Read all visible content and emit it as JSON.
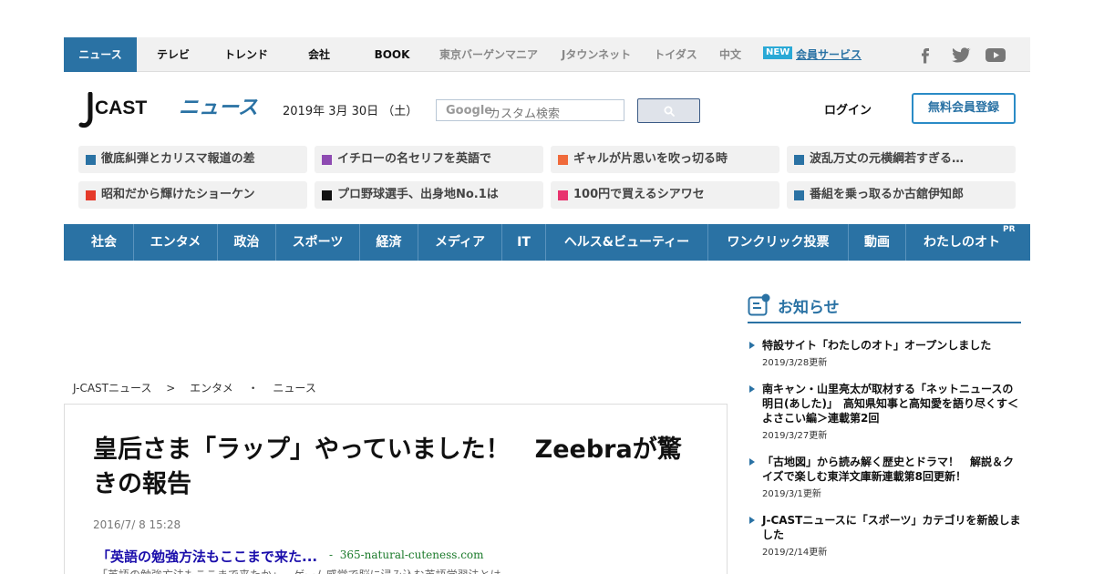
{
  "topnav": {
    "items": [
      "ニュース",
      "テレビ",
      "トレンド",
      "会社",
      "BOOK",
      "東京バーゲンマニア",
      "Jタウンネット",
      "トイダス",
      "中文"
    ],
    "new_badge": "NEW",
    "member_link": "会員サービス",
    "social_icons": [
      "facebook-icon",
      "twitter-icon",
      "youtube-icon"
    ]
  },
  "header": {
    "logo_j": "J",
    "logo_cast": "CAST",
    "logo_news": "ニュース",
    "date": "2019年 3月 30日 （土）",
    "search_brand": "Google",
    "search_placeholder": "カスタム検索",
    "login": "ログイン",
    "register": "無料会員登録"
  },
  "headlines": [
    {
      "text": "徹底糾弾とカリスマ報道の差",
      "color": "#2a72a4"
    },
    {
      "text": "イチローの名セリフを英語で",
      "color": "#8e4bb2"
    },
    {
      "text": "ギャルが片思いを吹っ切る時",
      "color": "#f06a3b"
    },
    {
      "text": "波乱万丈の元横綱若すぎる…",
      "color": "#2a72a4"
    },
    {
      "text": "昭和だから輝けたショーケン",
      "color": "#e53a2a"
    },
    {
      "text": "プロ野球選手、出身地No.1は",
      "color": "#111111"
    },
    {
      "text": "100円で買えるシアワセ",
      "color": "#e8336e"
    },
    {
      "text": "番組を乗っ取るか古舘伊知郎",
      "color": "#2a72a4"
    }
  ],
  "categories": [
    "社会",
    "エンタメ",
    "政治",
    "スポーツ",
    "経済",
    "メディア",
    "IT",
    "ヘルス&ビューティー",
    "ワンクリック投票",
    "動画",
    "わたしのオト"
  ],
  "pr_label": "PR",
  "breadcrumb": [
    "J-CASTニュース",
    ">",
    "エンタメ",
    "・",
    "ニュース"
  ],
  "article": {
    "title": "皇后さま「ラップ」やっていました！　Zeebraが驚きの報告",
    "date": "2016/7/ 8 15:28",
    "ad_title": "「英語の勉強方法もここまで来た...",
    "ad_sep": "-",
    "ad_url": "365-natural-cuteness.com",
    "ad_desc": "「英語の勉強方法もここまで来たか」…ゲーム感覚で脳に浸み込む英語学習法とは"
  },
  "sidebar": {
    "title": "お知らせ",
    "news": [
      {
        "title": "特設サイト「わたしのオト」オープンしました",
        "date": "2019/3/28更新"
      },
      {
        "title": "南キャン・山里亮太が取材する「ネットニュースの明日(あした)」　高知県知事と高知愛を語り尽くす＜よさこい編＞連載第2回",
        "date": "2019/3/27更新"
      },
      {
        "title": "「古地図」から読み解く歴史とドラマ！　解説＆クイズで楽しむ東洋文庫新連載第8回更新！",
        "date": "2019/3/1更新"
      },
      {
        "title": "J-CASTニュースに「スポーツ」カテゴリを新設しました",
        "date": "2019/2/14更新"
      }
    ]
  },
  "colors": {
    "accent": "#2a72a4",
    "nav_bg": "#f1f1f1",
    "link": "#1a0dab"
  }
}
